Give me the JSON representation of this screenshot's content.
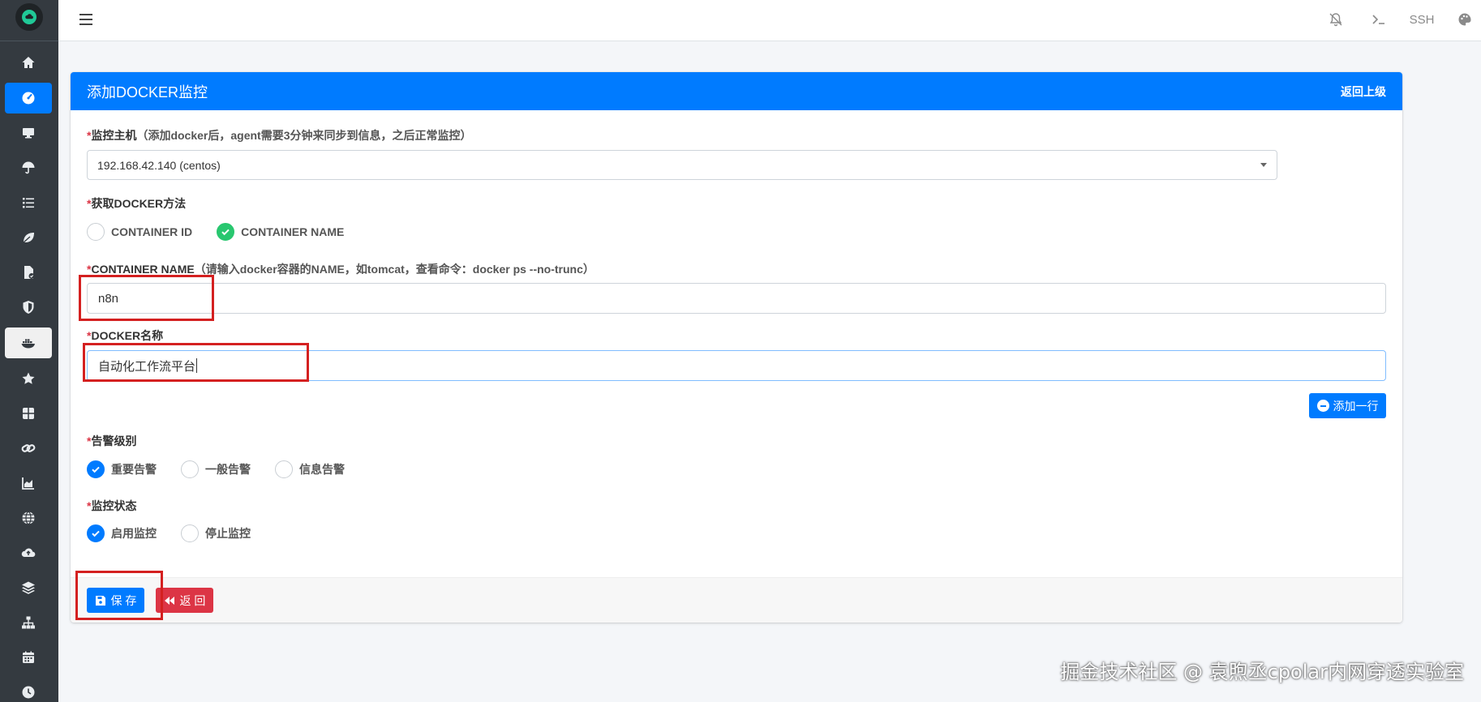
{
  "topbar": {
    "ssh_label": "SSH"
  },
  "card": {
    "title": "添加DOCKER监控",
    "back_link": "返回上级"
  },
  "fields": {
    "host": {
      "required_mark": "*",
      "label": "监控主机",
      "hint": "（添加docker后，agent需要3分钟来同步到信息，之后正常监控）",
      "selected": "192.168.42.140 (centos)"
    },
    "method": {
      "required_mark": "*",
      "label": "获取DOCKER方法",
      "options": [
        "CONTAINER ID",
        "CONTAINER NAME"
      ],
      "selected": "CONTAINER NAME"
    },
    "container_name": {
      "required_mark": "*",
      "label": "CONTAINER NAME",
      "hint": "（请输入docker容器的NAME，如tomcat，查看命令：docker ps --no-trunc）",
      "value": "n8n"
    },
    "docker_name": {
      "required_mark": "*",
      "label": "DOCKER名称",
      "value": "自动化工作流平台"
    },
    "add_row_label": "添加一行",
    "alert_level": {
      "required_mark": "*",
      "label": "告警级别",
      "options": [
        "重要告警",
        "一般告警",
        "信息告警"
      ],
      "selected": "重要告警"
    },
    "monitor_status": {
      "required_mark": "*",
      "label": "监控状态",
      "options": [
        "启用监控",
        "停止监控"
      ],
      "selected": "启用监控"
    }
  },
  "footer": {
    "save_label": "保 存",
    "back_label": "返 回"
  },
  "watermark": "掘金技术社区 @ 袁煦丞cpolar内网穿透实验室",
  "colors": {
    "primary": "#007bff",
    "danger": "#dc3545",
    "success": "#28c76f",
    "sidebar": "#343a40",
    "annotation": "#d42020"
  },
  "sidebar_icons": [
    "cloud-logo-icon",
    "home-icon",
    "dashboard-icon",
    "monitor-icon",
    "umbrella-icon",
    "task-list-icon",
    "leaf-icon",
    "file-check-icon",
    "shield-icon",
    "docker-icon",
    "star-icon",
    "grid-icon",
    "link-icon",
    "area-chart-icon",
    "globe-icon",
    "cloud-upload-icon",
    "layers-icon",
    "network-icon",
    "calendar-icon",
    "clock-icon"
  ]
}
